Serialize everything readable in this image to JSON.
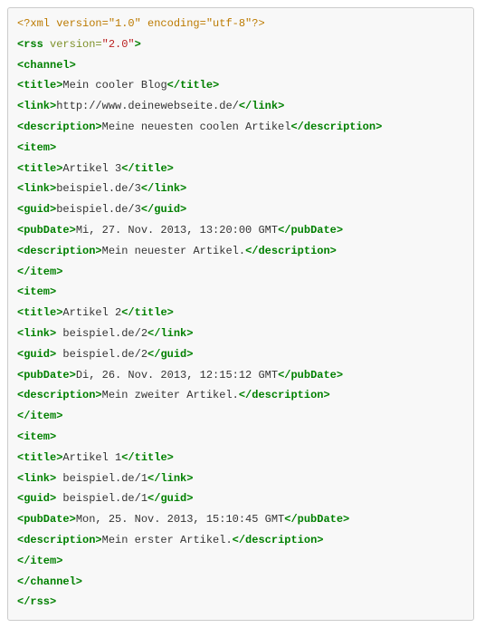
{
  "code": {
    "pi": "<?xml version=\"1.0\" encoding=\"utf-8\"?>",
    "rss_open_1": "<rss",
    "rss_open_attr": " version=",
    "rss_open_val": "\"2.0\"",
    "rss_open_2": ">",
    "channel_open": "<channel>",
    "title_open": "<title>",
    "title_close": "</title>",
    "link_open": "<link>",
    "link_close": "</link>",
    "desc_open": "<description>",
    "desc_close": "</description>",
    "item_open": "<item>",
    "item_close": "</item>",
    "guid_open": "<guid>",
    "guid_close": "</guid>",
    "pubdate_open": "<pubDate>",
    "pubdate_close": "</pubDate>",
    "channel_close": "</channel>",
    "rss_close": "</rss>",
    "channel_title": "Mein cooler Blog",
    "channel_link": "http://www.deinewebseite.de/",
    "channel_desc": "Meine neuesten coolen Artikel",
    "item1_title": "Artikel 3",
    "item1_link": "beispiel.de/3",
    "item1_guid": "beispiel.de/3",
    "item1_pubdate": "Mi, 27. Nov. 2013, 13:20:00 GMT",
    "item1_desc": "Mein neuester Artikel.",
    "item2_title": "Artikel 2",
    "item2_link_sp": " beispiel.de/2",
    "item2_guid_sp": " beispiel.de/2",
    "item2_pubdate": "Di, 26. Nov. 2013, 12:15:12 GMT",
    "item2_desc": "Mein zweiter Artikel.",
    "item3_title": "Artikel 1",
    "item3_link_sp": " beispiel.de/1",
    "item3_guid_sp": " beispiel.de/1",
    "item3_pubdate": "Mon, 25. Nov. 2013, 15:10:45 GMT",
    "item3_desc": "Mein erster Artikel."
  }
}
